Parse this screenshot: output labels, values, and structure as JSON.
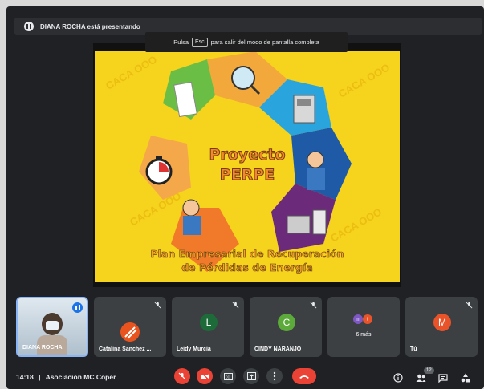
{
  "presenter_banner": {
    "text": "DIANA ROCHA está presentando"
  },
  "fullscreen_toast": {
    "prefix": "Pulsa",
    "key": "Esc",
    "suffix": "para salir del modo de pantalla completa"
  },
  "slide": {
    "title_line1": "Proyecto",
    "title_line2": "PERPE",
    "subtitle_line1": "Plan Empresarial de Recuperación",
    "subtitle_line2": "de Pérdidas de Energía",
    "watermark": "CACA OOO"
  },
  "participants": [
    {
      "name": "DIANA ROCHA",
      "kind": "video"
    },
    {
      "name": "Catalina Sanchez ...",
      "kind": "logo"
    },
    {
      "name": "Leidy Murcia",
      "kind": "letter",
      "letter": "L",
      "color": "#1e6b3a"
    },
    {
      "name": "CINDY NARANJO",
      "kind": "letter",
      "letter": "C",
      "color": "#5baa3a"
    },
    {
      "name": "6 más",
      "kind": "more",
      "mini": [
        "m",
        "t"
      ]
    },
    {
      "name": "Tú",
      "kind": "letter",
      "letter": "M",
      "color": "#e8532a"
    }
  ],
  "bottom": {
    "time": "14:18",
    "separator": "|",
    "meeting": "Asociación MC Coper",
    "people_count": "12"
  },
  "colors": {
    "background": "#202124",
    "tile": "#3c4043",
    "danger": "#ea4335",
    "accent": "#8ab4f8"
  }
}
